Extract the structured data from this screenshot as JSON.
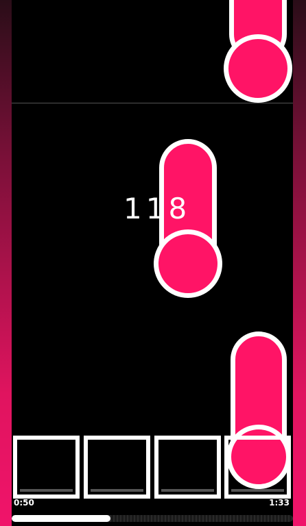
{
  "game": {
    "combo": "118",
    "time_elapsed": "0:50",
    "time_total": "1:33",
    "progress": 0.35
  },
  "lanes": {
    "count": 4
  },
  "colors": {
    "note": "#ff1466",
    "note_outline": "#ffffff",
    "background": "#000000",
    "side_gradient_bottom": "#f0146a"
  }
}
